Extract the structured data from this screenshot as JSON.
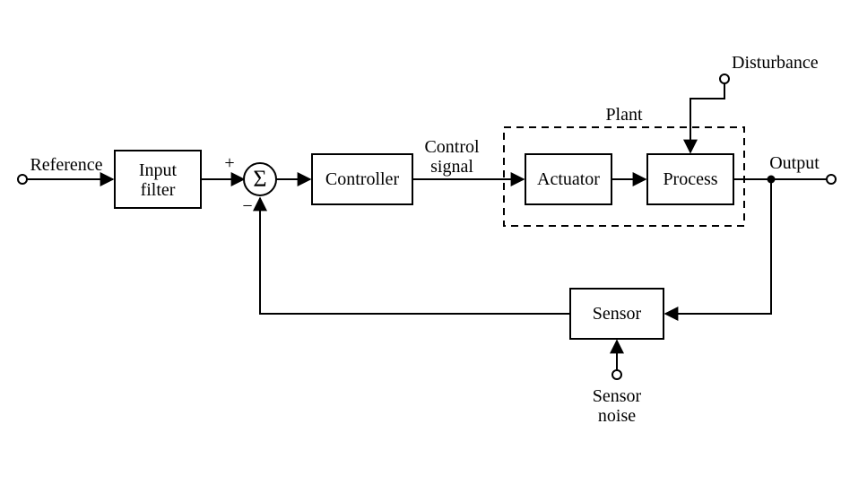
{
  "labels": {
    "reference": "Reference",
    "input_filter_l1": "Input",
    "input_filter_l2": "filter",
    "sum_symbol": "Σ",
    "plus": "+",
    "minus": "−",
    "controller": "Controller",
    "control_signal_l1": "Control",
    "control_signal_l2": "signal",
    "plant": "Plant",
    "actuator": "Actuator",
    "process": "Process",
    "disturbance": "Disturbance",
    "output": "Output",
    "sensor": "Sensor",
    "sensor_noise_l1": "Sensor",
    "sensor_noise_l2": "noise"
  },
  "diagram": {
    "layout": "closed-loop feedback control system",
    "blocks": [
      "Input filter",
      "Summing junction",
      "Controller",
      "Actuator",
      "Process",
      "Sensor"
    ],
    "groups": {
      "Plant": [
        "Actuator",
        "Process"
      ]
    },
    "external_signals": [
      "Reference",
      "Disturbance",
      "Sensor noise",
      "Output"
    ],
    "internal_signals": [
      "Control signal"
    ],
    "sum_inputs": [
      {
        "from": "Input filter",
        "sign": "+"
      },
      {
        "from": "Sensor",
        "sign": "-"
      }
    ],
    "connections": [
      {
        "from": "Reference (port)",
        "to": "Input filter"
      },
      {
        "from": "Input filter",
        "to": "Summing junction",
        "sign": "+"
      },
      {
        "from": "Summing junction",
        "to": "Controller"
      },
      {
        "from": "Controller",
        "to": "Actuator",
        "label": "Control signal"
      },
      {
        "from": "Actuator",
        "to": "Process"
      },
      {
        "from": "Disturbance (port)",
        "to": "Process"
      },
      {
        "from": "Process",
        "to": "Output (port)"
      },
      {
        "from": "Output tap",
        "to": "Sensor"
      },
      {
        "from": "Sensor noise (port)",
        "to": "Sensor"
      },
      {
        "from": "Sensor",
        "to": "Summing junction",
        "sign": "-"
      }
    ]
  }
}
